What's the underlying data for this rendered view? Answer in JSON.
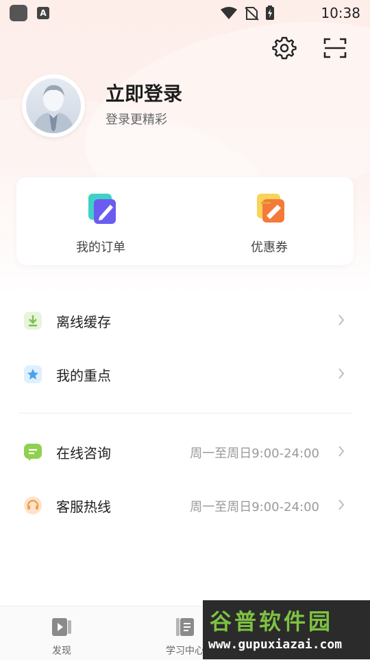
{
  "status_bar": {
    "time": "10:38",
    "app_badge": "A"
  },
  "header": {
    "settings_icon": "gear-icon",
    "scan_icon": "scan-icon"
  },
  "profile": {
    "title": "立即登录",
    "subtitle": "登录更精彩"
  },
  "quick_actions": [
    {
      "label": "我的订单",
      "icon": "orders-icon"
    },
    {
      "label": "优惠券",
      "icon": "coupon-icon"
    }
  ],
  "menu": [
    {
      "label": "离线缓存",
      "value": "",
      "icon": "download-icon",
      "color": "#7cc04a"
    },
    {
      "label": "我的重点",
      "value": "",
      "icon": "star-icon",
      "color": "#4aa3f0"
    },
    {
      "label": "在线咨询",
      "value": "周一至周日9:00-24:00",
      "icon": "chat-icon",
      "color": "#8fd14f"
    },
    {
      "label": "客服热线",
      "value": "周一至周日9:00-24:00",
      "icon": "headset-icon",
      "color": "#f2a04a"
    }
  ],
  "tabs": [
    {
      "label": "发现",
      "icon": "video-icon"
    },
    {
      "label": "学习中心",
      "icon": "book-icon"
    }
  ],
  "watermark": {
    "title": "谷普软件园",
    "url": "www.gupuxiazai.com"
  }
}
